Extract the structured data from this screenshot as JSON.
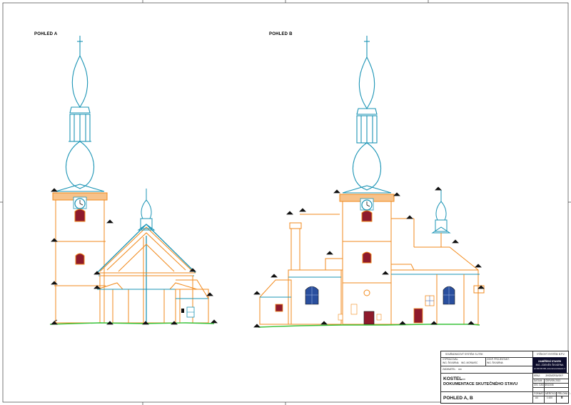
{
  "views": {
    "a_label": "POHLED A",
    "b_label": "POHLED B"
  },
  "colors": {
    "cyan": "#1b94b5",
    "orange": "#f28a1c",
    "ground": "#38c23a",
    "window_fill": "#8e1a2c",
    "window_blue": "#2a4f9e",
    "dark": "#111111"
  },
  "title_block": {
    "coord_top_left": "SOUŘADNICOVÝ SYSTÉM: S-JTSK",
    "coord_top_right": "VÝŠKOVÝ SYSTÉM: B.P.V.",
    "vypracoval_label": "VYPRACOVAL:",
    "vypracoval_value": "ING. ŠKVÁRNA",
    "zodp_label": "ZODP. PROJEKTANT:",
    "zodp_value": "ING. ŠKVÁRNA",
    "kontroloval_value": "ING. MORAVEC",
    "zakaznik_label": "ZADAVATEL:",
    "zakaznik_value": "xxx",
    "logo_line1": "ZAMĚŘENÍ STAVEB",
    "logo_line2": "ING. ZDENĚK ŠKVÁRNA",
    "logo_line3": "tel: 000 000 000, www.zamerenistaveb.cz",
    "kraj_label": "KRAJ:",
    "kraj_value": "JIHOMORAVSKÝ",
    "datum_label": "DATUM:",
    "datum_value": "ČERVEN 2013",
    "cislo_label": "ČÍS. ČÁSTI:",
    "cislo_value": "2013/08",
    "project_line1": "KOSTEL",
    "project_line1b": "xxx",
    "project_line2": "DOKUMENTACE  SKUTEČNÉHO  STAVU",
    "format_label": "FORMÁT:",
    "format_value": "A4",
    "meritko_label": "MĚŘÍTKO:",
    "meritko_value": "1:100",
    "priloha_label": "PŘÍLOHA Č.:",
    "priloha_value": "8",
    "drawing_name": "POHLED  A,  B"
  }
}
